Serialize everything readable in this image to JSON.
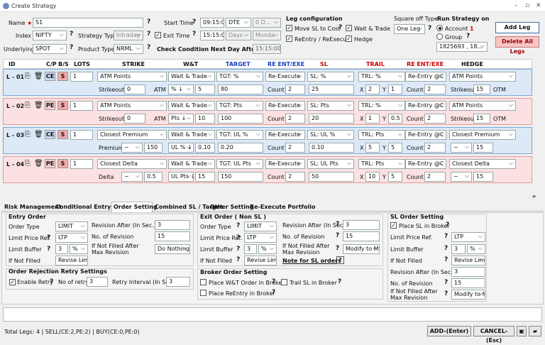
{
  "window": {
    "title": "Create Strategy"
  },
  "top": {
    "name_label": "Name",
    "name_value": "S1",
    "index_label": "Index",
    "index_value": "NIFTY",
    "underlying_label": "Underlying",
    "underlying_value": "SPOT",
    "strategy_type_label": "Strategy Type",
    "strategy_type_value": "Intraday",
    "product_type_label": "Product Type",
    "product_type_value": "NRML",
    "start_time_label": "Start Time",
    "start_time_value": "09:15:00",
    "start_mode": "DTE",
    "start_offset": "0 D...",
    "exit_time_label": "Exit Time",
    "exit_time_value": "15:15:00",
    "exit_mode": "Days",
    "exit_day": "Monda",
    "check_condition_label": "Check Condition Next Day After (Time)",
    "check_condition_value": "15:15:00"
  },
  "leg_config": {
    "title": "Leg configuration",
    "move_sl": "Move SL to Cost",
    "wait_trade": "Wait & Trade",
    "reentry": "ReEntry / ReExecute",
    "hedge": "Hedge"
  },
  "square_off": {
    "label": "Square off Type",
    "value": "One Leg"
  },
  "run_on": {
    "title": "Run Strategy on",
    "account": "Account",
    "account_count": "1",
    "group": "Group",
    "account_id": "1825693 , 18..."
  },
  "buttons": {
    "add_leg": "Add Leg",
    "delete_all": "Delete All Legs",
    "add_enter": "ADD-(Enter)",
    "cancel_esc": "CANCEL-(Esc)"
  },
  "headers": {
    "id": "ID",
    "cp": "C/P",
    "bs": "B/S",
    "lots": "LOTS",
    "strike": "STRIKE",
    "wt": "W&T",
    "target": "TARGET",
    "reent": "RE ENT/EXE",
    "sl": "SL",
    "trail": "TRAIL",
    "reent2": "RE ENT/EXE",
    "hedge": "HEDGE"
  },
  "legs": [
    {
      "id": "L - 01",
      "cp": "CE",
      "bs": "S",
      "lots": "1",
      "strike": "ATM Points",
      "wt": "Wait & Trade",
      "target": "TGT: %",
      "reent": "Re-Execute",
      "sl": "SL: %",
      "trail": "TRL: %",
      "reent2": "Re-Entry @C",
      "hedge": "ATM Points",
      "sub_label": "Strikeout",
      "sub_val": "0",
      "sub_unit": "ATM",
      "wt_unit": "% ↓",
      "wt_val": "5",
      "tgt_val": "80",
      "count_label": "Count",
      "count1": "2",
      "sl_val": "25",
      "x_label": "X",
      "x_val": "2",
      "y_label": "Y",
      "y_val": "1",
      "count2": "2",
      "hedge_label": "Strikeout",
      "hedge_val": "15",
      "hedge_unit": "OTM"
    },
    {
      "id": "L - 02",
      "cp": "PE",
      "bs": "S",
      "lots": "1",
      "strike": "ATM Points",
      "wt": "Wait & Trade",
      "target": "TGT: Pts",
      "reent": "Re-Execute",
      "sl": "SL: Pts",
      "trail": "TRL: %",
      "reent2": "Re-Entry @C",
      "hedge": "ATM Points",
      "sub_label": "Strikeout",
      "sub_val": "0",
      "sub_unit": "ATM",
      "wt_unit": "Pts ↓",
      "wt_val": "10",
      "tgt_val": "100",
      "count_label": "Count",
      "count1": "2",
      "sl_val": "20",
      "x_label": "X",
      "x_val": "1",
      "y_label": "Y",
      "y_val": "0.5",
      "count2": "2",
      "hedge_label": "Strikeout",
      "hedge_val": "15",
      "hedge_unit": "OTM"
    },
    {
      "id": "L - 03",
      "cp": "CE",
      "bs": "S",
      "lots": "1",
      "strike": "Closest Premium",
      "wt": "Wait & Trade",
      "target": "TGT: UL %",
      "reent": "Re-Execute",
      "sl": "SL: UL %",
      "trail": "TRL: Pts",
      "reent2": "Re-Entry @C",
      "hedge": "Closest Premium",
      "sub_label": "Premium",
      "sub_op": "~",
      "sub_val": "150",
      "sub_unit": "",
      "wt_unit": "UL % ↓",
      "wt_val": "0.10",
      "tgt_val": "0.20",
      "count_label": "Count",
      "count1": "2",
      "sl_val": "0.10",
      "x_label": "X",
      "x_val": "5",
      "y_label": "Y",
      "y_val": "5",
      "count2": "2",
      "hedge_label": "",
      "hedge_op": "~",
      "hedge_val": "15",
      "hedge_unit": ""
    },
    {
      "id": "L - 04",
      "cp": "PE",
      "bs": "S",
      "lots": "1",
      "strike": "Closest Delta",
      "wt": "Wait & Trade",
      "target": "TGT: UL Pts",
      "reent": "Re-Execute",
      "sl": "SL: UL Pts",
      "trail": "TRL: Pts",
      "reent2": "Re-Entry @C",
      "hedge": "Closest Delta",
      "sub_label": "Delta",
      "sub_op": "~",
      "sub_val": "0.5",
      "sub_unit": "",
      "wt_unit": "UL Pts ↓",
      "wt_val": "15",
      "tgt_val": "150",
      "count_label": "Count",
      "count1": "2",
      "sl_val": "50",
      "x_label": "X",
      "x_val": "10",
      "y_label": "Y",
      "y_val": "5",
      "count2": "2",
      "hedge_label": "",
      "hedge_op": "~",
      "hedge_val": "15",
      "hedge_unit": ""
    }
  ],
  "tabs": [
    "Risk Management",
    "Conditional Entry / Exit",
    "Order Setting",
    "Combined SL / Target",
    "Other Setting",
    "Re-Execute Portfolio"
  ],
  "entry_order": {
    "title": "Entry Order",
    "order_type_label": "Order Type",
    "order_type": "LIMIT",
    "limit_ref_label": "Limit Price Ref.",
    "limit_ref": "LTP",
    "buffer_label": "Limit Buffer",
    "buffer_val": "3",
    "buffer_unit": "%",
    "not_filled_label": "If Not Filled",
    "not_filled": "Revise Limi",
    "rev_after_label": "Revision After (In Sec.)",
    "rev_after": "3",
    "no_rev_label": "No. of Revision",
    "no_rev": "15",
    "max_rev_label": "If Not Filled After Max Revision",
    "max_rev": "Do Nothing"
  },
  "rejection": {
    "title": "Order Rejection Retry Settings",
    "enable": "Enable Retry",
    "no_retry_label": "No of retry",
    "no_retry": "3",
    "interval_label": "Retry Interval (In Sec.)",
    "interval": "3"
  },
  "exit_order": {
    "title": "Exit Order ( Non SL )",
    "order_type_label": "Order Type",
    "order_type": "LIMIT",
    "limit_ref_label": "Limit Price Ref.",
    "limit_ref": "LTP",
    "buffer_label": "Limit Buffer",
    "buffer_val": "3",
    "buffer_unit": "%",
    "not_filled_label": "If Not Filled",
    "not_filled": "Revise Limi",
    "rev_after_label": "Revision After (In Sec.)",
    "rev_after": "3",
    "no_rev_label": "No. of Revision",
    "no_rev": "15",
    "max_rev_label": "If Not Filled After Max Revision",
    "max_rev": "Modify to M",
    "note": "Note for SL orders",
    "note_q": "?"
  },
  "broker": {
    "title": "Broker Order Setting",
    "wt": "Place W&T Order in Broker",
    "trail": "Trail SL in Broker",
    "reentry": "Place ReEntry in Broker"
  },
  "sl_order": {
    "title": "SL Order Setting",
    "place": "Place SL in Broker",
    "limit_ref_label": "Limit Price Ref.",
    "limit_ref": "LTP",
    "buffer_label": "Limit Buffer",
    "buffer_val": "3",
    "buffer_unit": "%",
    "not_filled_label": "If Not Filled",
    "not_filled": "Revise Limi",
    "rev_after_label": "Revision After (In Sec.)",
    "rev_after": "3",
    "no_rev_label": "No. of Revision",
    "no_rev": "15",
    "max_rev_label": "If Not Filled After Max Revision",
    "max_rev": "Modify to M"
  },
  "status": {
    "text": "Total Legs: 4  |  SELL(CE:2,PE:2)  |  BUY(CE:0,PE:0)"
  },
  "colors": {
    "ce_tag": "#c9d9ef",
    "pe_tag": "#f5cccc",
    "s_tag": "#f4a9a9",
    "blue_row": "#dde9f7",
    "pink_row": "#fbe1e1",
    "delete_btn": "#f7c6c6",
    "target_header": "#1f3fbf",
    "sl_header": "#d00000"
  }
}
